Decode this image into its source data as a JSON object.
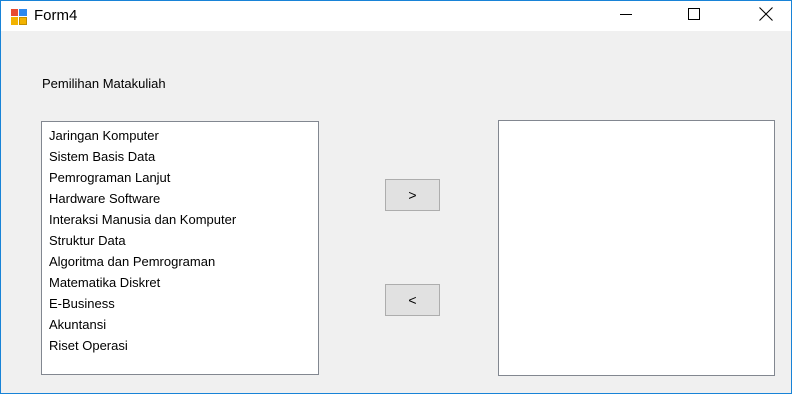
{
  "window": {
    "title": "Form4",
    "icon": "winforms-form-icon",
    "controls": [
      "minimize-icon",
      "maximize-icon",
      "close-icon"
    ]
  },
  "form": {
    "label": "Pemilihan Matakuliah",
    "left_list": {
      "items": [
        "Jaringan Komputer",
        "Sistem Basis Data",
        "Pemrograman Lanjut",
        "Hardware Software",
        "Interaksi Manusia dan Komputer",
        "Struktur Data",
        "Algoritma dan Pemrograman",
        "Matematika Diskret",
        "E-Business",
        "Akuntansi",
        "Riset Operasi"
      ]
    },
    "right_list": {
      "items": []
    },
    "add_button_label": ">",
    "remove_button_label": "<"
  },
  "colors": {
    "window_border": "#1883d7",
    "client_background": "#f0f0f0",
    "button_background": "#e1e1e1",
    "listbox_border": "#828790"
  }
}
